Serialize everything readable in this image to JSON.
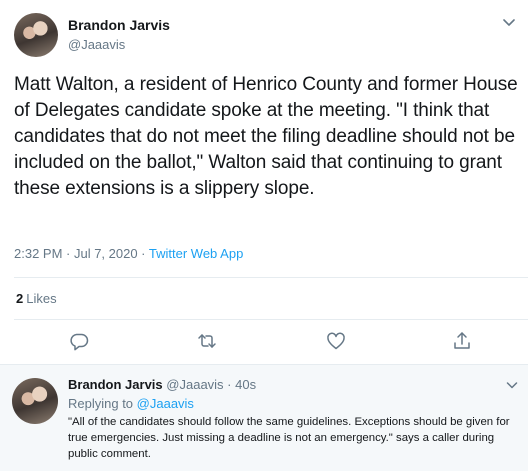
{
  "main_tweet": {
    "author_name": "Brandon Jarvis",
    "author_handle": "@Jaaavis",
    "text": "Matt Walton, a resident of Henrico County and former House of Delegates candidate spoke at the meeting. \"I think that candidates that do not meet the filing deadline should not be included on the ballot,\" Walton said that continuing to grant these extensions is a slippery slope.",
    "timestamp": "2:32 PM · Jul 7, 2020 · ",
    "source": "Twitter Web App",
    "likes_count": "2",
    "likes_label": "Likes",
    "actions": [
      "reply-icon",
      "retweet-icon",
      "like-icon",
      "share-icon"
    ]
  },
  "reply_tweet": {
    "author_name": "Brandon Jarvis",
    "author_handle": "@Jaaavis",
    "separator": " · ",
    "time_ago": "40s",
    "replying_to_label": "Replying to ",
    "replying_to_handle": "@Jaaavis",
    "text": "\"All of the candidates should follow the same guidelines. Exceptions should be given for true emergencies. Just missing a deadline is not an emergency.\" says a caller during public comment."
  },
  "colors": {
    "text": "#14171a",
    "secondary": "#657786",
    "accent": "#1da1f2",
    "reply_bg": "#f5f8fa",
    "divider": "#e6ecf0"
  }
}
